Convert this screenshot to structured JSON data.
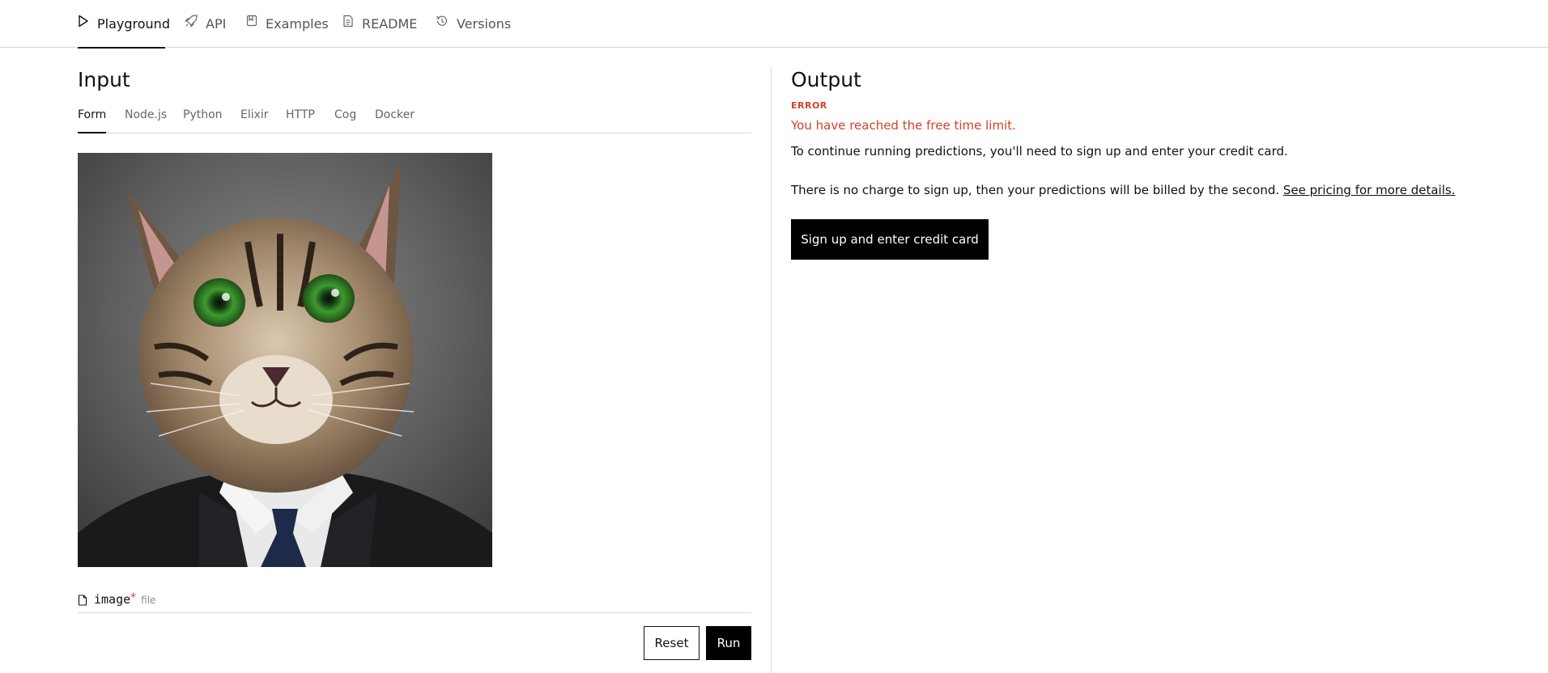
{
  "nav": {
    "tabs": [
      {
        "label": "Playground",
        "icon": "play-icon",
        "active": true
      },
      {
        "label": "API",
        "icon": "rocket-icon"
      },
      {
        "label": "Examples",
        "icon": "bookmark-icon"
      },
      {
        "label": "README",
        "icon": "document-icon"
      },
      {
        "label": "Versions",
        "icon": "history-icon"
      }
    ]
  },
  "input": {
    "title": "Input",
    "tabs": [
      "Form",
      "Node.js",
      "Python",
      "Elixir",
      "HTTP",
      "Cog",
      "Docker"
    ],
    "active_tab": "Form",
    "field": {
      "name": "image",
      "required_mark": "*",
      "type": "file"
    },
    "reset_label": "Reset",
    "run_label": "Run"
  },
  "output": {
    "title": "Output",
    "error_label": "ERROR",
    "error_message": "You have reached the free time limit.",
    "continue_message": "To continue running predictions, you'll need to sign up and enter your credit card.",
    "charge_message": "There is no charge to sign up, then your predictions will be billed by the second.",
    "pricing_link": "See pricing for more details.",
    "signup_label": "Sign up and enter credit card"
  },
  "colors": {
    "accent": "#000000",
    "error": "#d0432a",
    "border": "#d9d9d9"
  }
}
